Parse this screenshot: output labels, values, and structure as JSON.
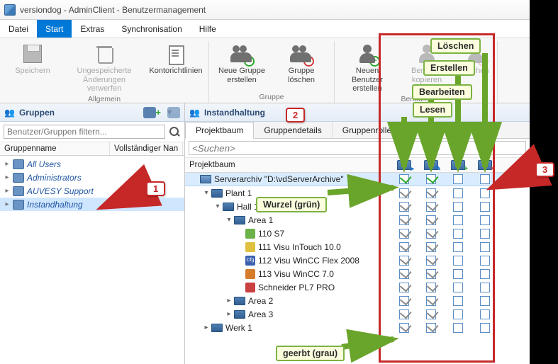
{
  "title": "versiondog - AdminClient - Benutzermanagement",
  "menu": {
    "datei": "Datei",
    "start": "Start",
    "extras": "Extras",
    "sync": "Synchronisation",
    "hilfe": "Hilfe"
  },
  "ribbon": {
    "allgemein_label": "Allgemein",
    "gruppe_label": "Gruppe",
    "benutzer_label": "Benutzer",
    "save": "Speichern",
    "discard": "Ungespeicherte\nÄnderungen verwerfen",
    "konto": "Kontorichtlinien",
    "grp_new": "Neue Gruppe\nerstellen",
    "grp_del": "Gruppe\nlöschen",
    "usr_new": "Neuen Benutzer\nerstellen",
    "usr_copy": "Benutzer\nkopieren",
    "usr_del": "löschen"
  },
  "left": {
    "pane_title": "Gruppen",
    "filter_placeholder": "Benutzer/Gruppen filtern...",
    "col_name": "Gruppenname",
    "col_full": "Vollständiger Nan",
    "groups": [
      {
        "label": "All Users"
      },
      {
        "label": "Administrators"
      },
      {
        "label": "AUVESY Support"
      },
      {
        "label": "Instandhaltung",
        "selected": true
      }
    ]
  },
  "right": {
    "pane_title": "Instandhaltung",
    "tabs": {
      "baum": "Projektbaum",
      "details": "Gruppendetails",
      "rollen": "Gruppenrollen"
    },
    "search_placeholder": "<Suchen>",
    "col_tree": "Projektbaum",
    "rows": [
      {
        "indent": 0,
        "exp": "",
        "icon": "server",
        "label": "Serverarchiv \"D:\\vdServerArchive\"",
        "root": true,
        "perm": [
          "g",
          "g",
          "",
          ""
        ]
      },
      {
        "indent": 1,
        "exp": "v",
        "icon": "fold",
        "label": "Plant 1",
        "perm": [
          "c",
          "c",
          "",
          ""
        ]
      },
      {
        "indent": 2,
        "exp": "v",
        "icon": "fold",
        "label": "Hall 1",
        "perm": [
          "c",
          "c",
          "",
          ""
        ]
      },
      {
        "indent": 3,
        "exp": "v",
        "icon": "fold",
        "label": "Area 1",
        "perm": [
          "c",
          "c",
          "",
          ""
        ]
      },
      {
        "indent": 4,
        "exp": "",
        "icon": "s7",
        "label": "110 S7",
        "perm": [
          "c",
          "c",
          "",
          ""
        ]
      },
      {
        "indent": 4,
        "exp": "",
        "icon": "it",
        "label": "111 Visu InTouch 10.0",
        "perm": [
          "c",
          "c",
          "",
          ""
        ]
      },
      {
        "indent": 4,
        "exp": "",
        "icon": "flex",
        "label": "112 Visu WinCC Flex 2008",
        "perm": [
          "c",
          "c",
          "",
          ""
        ]
      },
      {
        "indent": 4,
        "exp": "",
        "icon": "wcc",
        "label": "113 Visu WinCC 7.0",
        "perm": [
          "c",
          "c",
          "",
          ""
        ]
      },
      {
        "indent": 4,
        "exp": "",
        "icon": "pl7",
        "label": "Schneider PL7 PRO",
        "perm": [
          "c",
          "c",
          "",
          ""
        ]
      },
      {
        "indent": 3,
        "exp": ">",
        "icon": "fold",
        "label": "Area 2",
        "perm": [
          "c",
          "c",
          "",
          ""
        ]
      },
      {
        "indent": 3,
        "exp": ">",
        "icon": "fold",
        "label": "Area 3",
        "perm": [
          "c",
          "c",
          "",
          ""
        ]
      },
      {
        "indent": 1,
        "exp": ">",
        "icon": "fold",
        "label": "Werk 1",
        "perm": [
          "c",
          "c",
          "",
          ""
        ]
      }
    ]
  },
  "annotations": {
    "lesen": "Lesen",
    "bearbeiten": "Bearbeiten",
    "erstellen": "Erstellen",
    "loeschen": "Löschen",
    "wurzel": "Wurzel (grün)",
    "geerbt": "geerbt (grau)",
    "n1": "1",
    "n2": "2",
    "n3": "3"
  }
}
